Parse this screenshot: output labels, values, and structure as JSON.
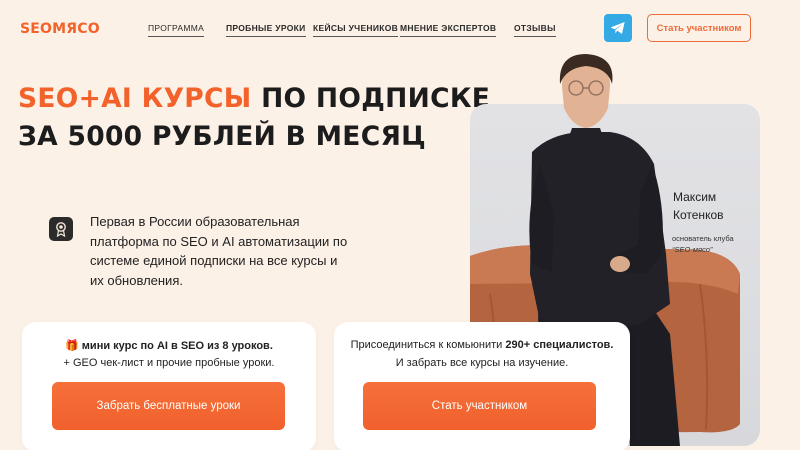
{
  "header": {
    "logo": "SEOMЯСО",
    "nav": [
      {
        "label": "ПРОГРАММА"
      },
      {
        "label": "ПРОБНЫЕ УРОКИ"
      },
      {
        "label": "КЕЙСЫ УЧЕНИКОВ"
      },
      {
        "label": "МНЕНИЕ ЭКСПЕРТОВ"
      },
      {
        "label": "ОТЗЫВЫ"
      }
    ],
    "telegram_icon": "telegram-icon",
    "cta_label": "Стать участником"
  },
  "hero": {
    "headline_accent": "SEO+AI КУРСЫ",
    "headline_rest": " ПО ПОДПИСКЕ",
    "headline_line2": "ЗА 5000 РУБЛЕЙ В МЕСЯЦ",
    "info_icon": "award-icon",
    "description": "Первая в России образовательная платформа по SEO и AI автоматизации по системе единой подписки на все курсы и их обновления."
  },
  "speaker": {
    "first_name": "Максим",
    "last_name": "Котенков",
    "role": "основатель клуба",
    "club": "“SEO-мясо”"
  },
  "cards": [
    {
      "icon": "gift-icon",
      "line1_prefix": "мини курс по AI в SEO из 8 уроков.",
      "line2": "+ GEO чек-лист и прочие пробные уроки.",
      "button": "Забрать бесплатные уроки"
    },
    {
      "line1_prefix": "Присоединиться к комьюнити ",
      "line1_bold": "290+ специалистов.",
      "line2": "И забрать все курсы на изучение.",
      "button": "Стать участником"
    }
  ],
  "colors": {
    "accent": "#f2622a",
    "background": "#fcf1e7",
    "telegram": "#34a9e4"
  }
}
